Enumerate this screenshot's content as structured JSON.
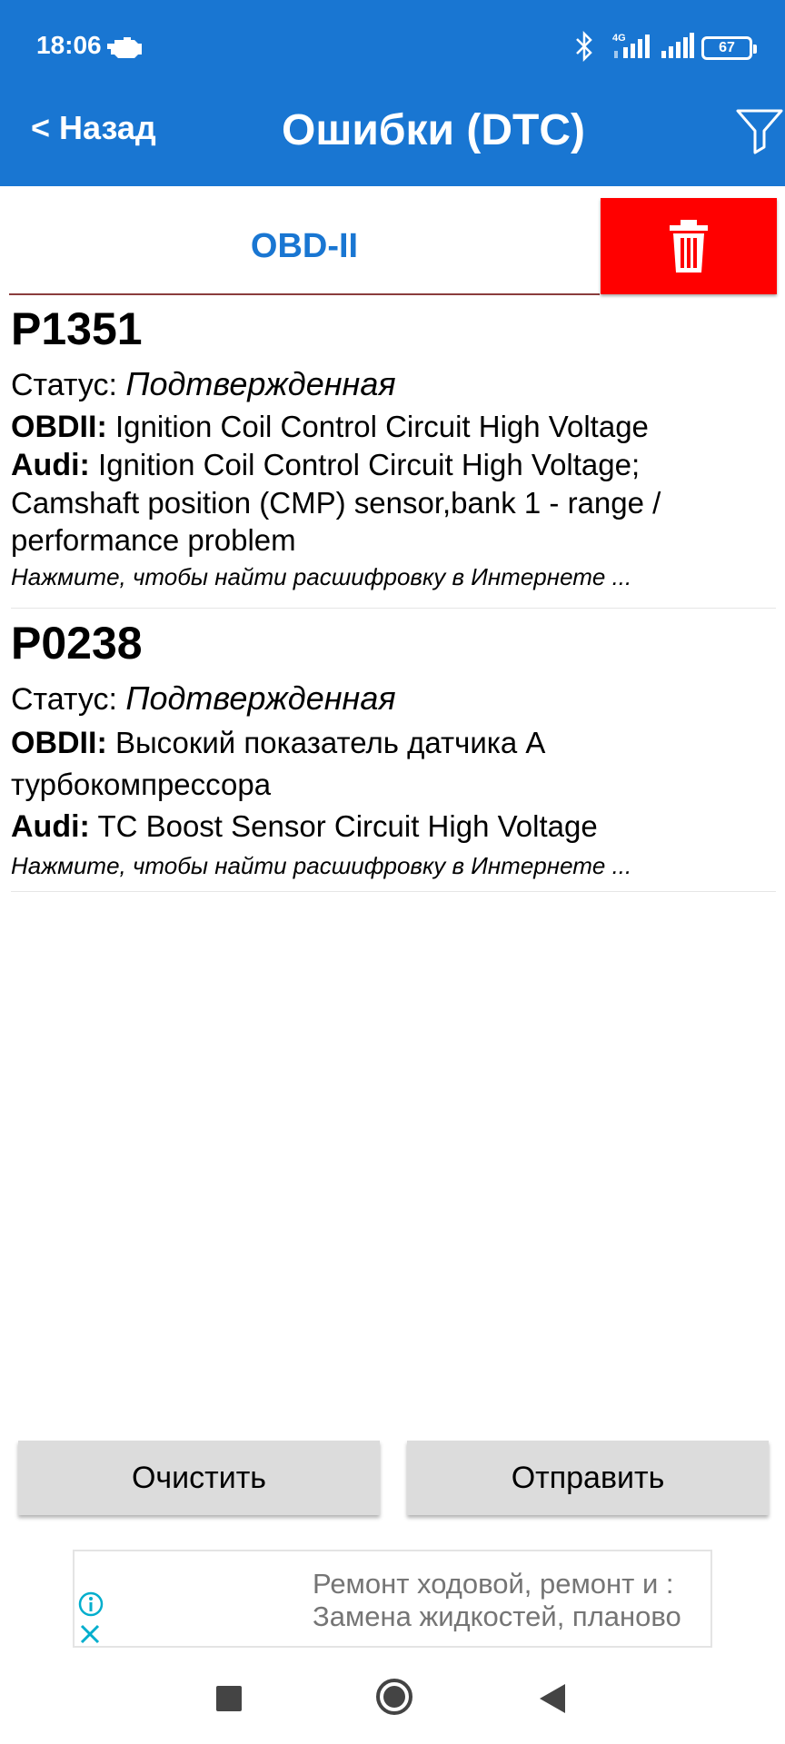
{
  "status_bar": {
    "time": "18:06",
    "battery": "67",
    "network": "4G"
  },
  "header": {
    "back_label": "< Назад",
    "title": "Ошибки (DTC)",
    "background_color": "#1976d2"
  },
  "tabs": {
    "active_label": "OBD-II",
    "delete_color": "#ff0000"
  },
  "dtc_list": [
    {
      "code": "P1351",
      "status_label": "Статус:",
      "status_value": "Подтвержденная",
      "obd_label": "OBDII:",
      "obd_text": "Ignition Coil Control Circuit High Voltage",
      "maker_label": "Audi:",
      "maker_text_line1": "Ignition Coil Control Circuit High Voltage;",
      "maker_text_line2": "Camshaft position (CMP) sensor,bank 1 - range /",
      "maker_text_line3": "performance problem",
      "hint": "Нажмите, чтобы найти расшифровку в Интернете ..."
    },
    {
      "code": "P0238",
      "status_label": "Статус:",
      "status_value": "Подтвержденная",
      "obd_label": "OBDII:",
      "obd_text_line1": "Высокий показатель датчика А",
      "obd_text_line2": "турбокомпрессора",
      "maker_label": "Audi:",
      "maker_text": "TC Boost Sensor Circuit High Voltage",
      "hint": "Нажмите, чтобы найти расшифровку в Интернете ..."
    }
  ],
  "buttons": {
    "clear": "Очистить",
    "send": "Отправить"
  },
  "ad": {
    "line1": "Ремонт ходовой, ремонт и :",
    "line2": "Замена жидкостей, планово"
  }
}
